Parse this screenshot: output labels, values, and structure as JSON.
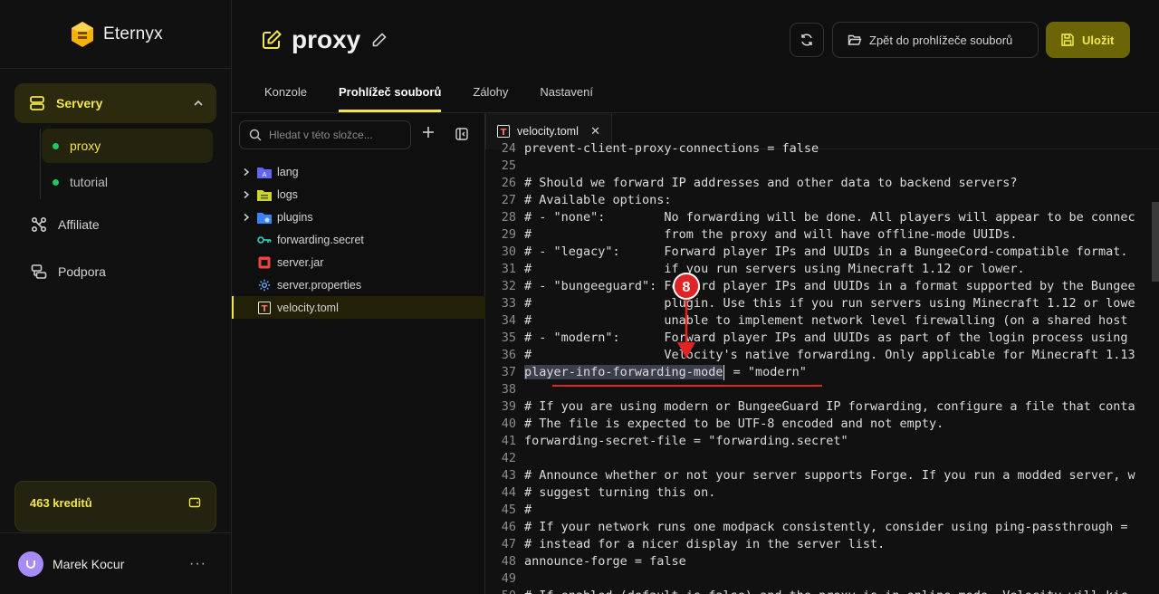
{
  "brand": {
    "name": "Eternyx"
  },
  "sidebar": {
    "servers_label": "Servery",
    "servers": [
      {
        "name": "proxy",
        "status": "online"
      },
      {
        "name": "tutorial",
        "status": "online"
      }
    ],
    "items": [
      {
        "label": "Affiliate",
        "icon": "affiliate-icon"
      },
      {
        "label": "Podpora",
        "icon": "support-icon"
      }
    ],
    "credits": "463 kreditů",
    "user": {
      "name": "Marek Kocur",
      "more": "···"
    }
  },
  "header": {
    "title": "proxy",
    "back_button": "Zpět do prohlížeče souborů",
    "save_button": "Uložit",
    "tabs": [
      "Konzole",
      "Prohlížeč souborů",
      "Zálohy",
      "Nastavení"
    ],
    "active_tab": "Prohlížeč souborů"
  },
  "file_browser": {
    "search_placeholder": "Hledat v této složce...",
    "entries": [
      {
        "name": "lang",
        "type": "folder"
      },
      {
        "name": "logs",
        "type": "folder"
      },
      {
        "name": "plugins",
        "type": "folder"
      },
      {
        "name": "forwarding.secret",
        "type": "key"
      },
      {
        "name": "server.jar",
        "type": "jar"
      },
      {
        "name": "server.properties",
        "type": "properties"
      },
      {
        "name": "velocity.toml",
        "type": "toml",
        "selected": true
      }
    ]
  },
  "editor": {
    "tab": "velocity.toml",
    "lines": [
      {
        "n": "24",
        "text": "prevent-client-proxy-connections = false"
      },
      {
        "n": "25",
        "text": ""
      },
      {
        "n": "26",
        "text": "# Should we forward IP addresses and other data to backend servers?"
      },
      {
        "n": "27",
        "text": "# Available options:"
      },
      {
        "n": "28",
        "text": "# - \"none\":        No forwarding will be done. All players will appear to be connec"
      },
      {
        "n": "29",
        "text": "#                  from the proxy and will have offline-mode UUIDs."
      },
      {
        "n": "30",
        "text": "# - \"legacy\":      Forward player IPs and UUIDs in a BungeeCord-compatible format."
      },
      {
        "n": "31",
        "text": "#                  if you run servers using Minecraft 1.12 or lower."
      },
      {
        "n": "32",
        "text": "# - \"bungeeguard\": Forward player IPs and UUIDs in a format supported by the Bungee"
      },
      {
        "n": "33",
        "text": "#                  plugin. Use this if you run servers using Minecraft 1.12 or lowe"
      },
      {
        "n": "34",
        "text": "#                  unable to implement network level firewalling (on a shared host"
      },
      {
        "n": "35",
        "text": "# - \"modern\":      Forward player IPs and UUIDs as part of the login process using"
      },
      {
        "n": "36",
        "text": "#                  Velocity's native forwarding. Only applicable for Minecraft 1.13"
      },
      {
        "n": "37",
        "text_selected": "player-info-forwarding-mode",
        "text_rest": " = \"modern\""
      },
      {
        "n": "38",
        "text": ""
      },
      {
        "n": "39",
        "text": "# If you are using modern or BungeeGuard IP forwarding, configure a file that conta"
      },
      {
        "n": "40",
        "text": "# The file is expected to be UTF-8 encoded and not empty."
      },
      {
        "n": "41",
        "text": "forwarding-secret-file = \"forwarding.secret\""
      },
      {
        "n": "42",
        "text": ""
      },
      {
        "n": "43",
        "text": "# Announce whether or not your server supports Forge. If you run a modded server, w"
      },
      {
        "n": "44",
        "text": "# suggest turning this on."
      },
      {
        "n": "45",
        "text": "#"
      },
      {
        "n": "46",
        "text": "# If your network runs one modpack consistently, consider using ping-passthrough ="
      },
      {
        "n": "47",
        "text": "# instead for a nicer display in the server list."
      },
      {
        "n": "48",
        "text": "announce-forge = false"
      },
      {
        "n": "49",
        "text": ""
      },
      {
        "n": "50",
        "text": "# If enabled (default is false) and the proxy is in online mode, Velocity will kic"
      }
    ]
  },
  "annotation": {
    "step": "8",
    "color": "#e02424"
  },
  "colors": {
    "accent": "#f2e64a",
    "online": "#22c55e",
    "background": "#0f0f0f"
  }
}
